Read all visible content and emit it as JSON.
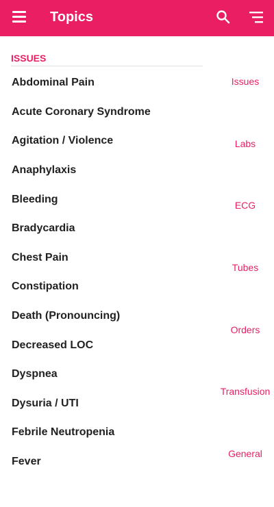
{
  "appbar": {
    "title": "Topics",
    "icons": [
      "menu-icon",
      "search-icon",
      "sort-icon"
    ],
    "color": "#e91e63"
  },
  "section": {
    "header": "ISSUES"
  },
  "topics": [
    "Abdominal Pain",
    "Acute Coronary Syndrome",
    "Agitation / Violence",
    "Anaphylaxis",
    "Bleeding",
    "Bradycardia",
    "Chest Pain",
    "Constipation",
    "Death (Pronouncing)",
    "Decreased LOC",
    "Dyspnea",
    "Dysuria / UTI",
    "Febrile Neutropenia",
    "Fever"
  ],
  "index": [
    "Issues",
    "Labs",
    "ECG",
    "Tubes",
    "Orders",
    "Transfusion",
    "General"
  ]
}
